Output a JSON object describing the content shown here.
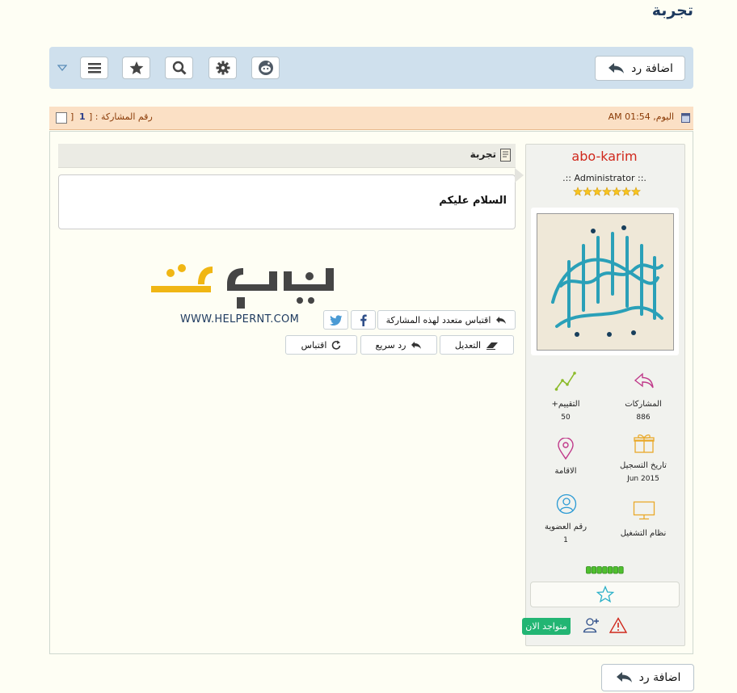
{
  "page": {
    "title": "تجربة"
  },
  "toolbar": {
    "reply_label": "اضافة رد"
  },
  "post": {
    "date": "اليوم, 01:54 AM",
    "number_label": "رقم المشاركة : [",
    "number": "1",
    "number_close": "]",
    "subject": "تجربة",
    "message": "السلام عليكم",
    "logo_text": "WWW.HELPERNT.COM",
    "multi_quote_label": "اقتباس متعدد لهذه المشاركة",
    "edit_label": "التعديل",
    "quick_reply_label": "رد سريع",
    "quote_label": "اقتباس"
  },
  "user": {
    "name": "abo-karim",
    "rank": ".:: Administrator ::.",
    "stats": [
      {
        "label": "المشاركات",
        "value": "886"
      },
      {
        "label": "+التقييم",
        "value": "50"
      },
      {
        "label": "تاريخ التسجيل",
        "value": "Jun 2015"
      },
      {
        "label": "الاقامة",
        "value": ""
      },
      {
        "label": "نظام التشغيل",
        "value": ""
      },
      {
        "label": "رقم العضوية",
        "value": "1"
      }
    ],
    "online_label": "متواجد الان",
    "colors": {
      "name": "#d0281c",
      "online": "#22b573"
    }
  },
  "footer": {
    "reply_label": "اضافة رد"
  }
}
